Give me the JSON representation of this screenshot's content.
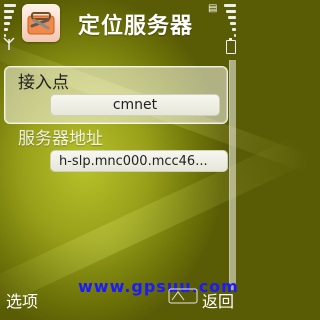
{
  "header": {
    "title": "定位服务器",
    "app_icon": "toolbox-icon",
    "signal_icon": "signal-antenna-icon",
    "battery_icon": "battery-icon"
  },
  "settings": {
    "items": [
      {
        "label": "接入点",
        "value": "cmnet",
        "selected": true
      },
      {
        "label": "服务器地址",
        "value": "h-slp.mnc000.mcc46...",
        "selected": false
      }
    ]
  },
  "softkeys": {
    "left": "选项",
    "right": "返回"
  },
  "watermark": {
    "text": "www.gpsuu.com"
  },
  "colors": {
    "background": "#98a01a",
    "text_primary": "#222222",
    "text_light": "#f2f2e6",
    "watermark": "#1a1aff"
  }
}
